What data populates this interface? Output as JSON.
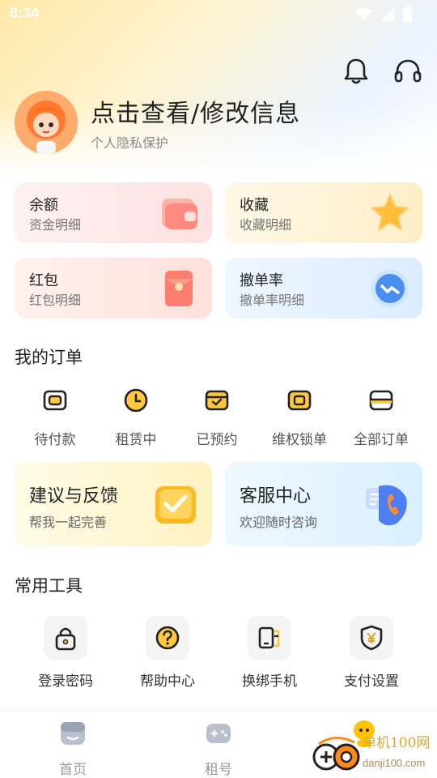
{
  "status_bar": {
    "time": "8:34"
  },
  "header": {
    "icons": [
      "bell-icon",
      "headset-icon"
    ]
  },
  "profile": {
    "title": "点击查看/修改信息",
    "subtitle": "个人隐私保护"
  },
  "assets": [
    {
      "title": "余额",
      "sub": "资金明细",
      "icon": "wallet-icon"
    },
    {
      "title": "收藏",
      "sub": "收藏明细",
      "icon": "star-icon"
    },
    {
      "title": "红包",
      "sub": "红包明细",
      "icon": "red-envelope-icon"
    },
    {
      "title": "撤单率",
      "sub": "撤单率明细",
      "icon": "trend-icon"
    }
  ],
  "orders": {
    "title": "我的订单",
    "items": [
      {
        "label": "待付款",
        "icon": "wallet-icon"
      },
      {
        "label": "租赁中",
        "icon": "clock-icon"
      },
      {
        "label": "已预约",
        "icon": "calendar-check-icon"
      },
      {
        "label": "维权锁单",
        "icon": "lock-order-icon"
      },
      {
        "label": "全部订单",
        "icon": "card-icon"
      }
    ]
  },
  "services": [
    {
      "title": "建议与反馈",
      "sub": "帮我一起完善",
      "icon": "checkbox-icon"
    },
    {
      "title": "客服中心",
      "sub": "欢迎随时咨询",
      "icon": "phone-icon"
    }
  ],
  "tools": {
    "title": "常用工具",
    "items": [
      {
        "label": "登录密码",
        "icon": "lock-icon"
      },
      {
        "label": "帮助中心",
        "icon": "question-icon"
      },
      {
        "label": "换绑手机",
        "icon": "phone-swap-icon"
      },
      {
        "label": "支付设置",
        "icon": "shield-yen-icon"
      }
    ]
  },
  "bottom_nav": [
    {
      "label": "首页",
      "icon": "home-icon"
    },
    {
      "label": "租号",
      "icon": "gamepad-icon"
    },
    {
      "label": "",
      "icon": "profile-icon",
      "active": true
    }
  ],
  "watermark": {
    "text_cn": "单机100网",
    "text_en": "danji100.com"
  },
  "colors": {
    "accent_yellow": "#ffc83d",
    "text_gray": "#8a8a8a",
    "nav_gray": "#9a9a9a"
  }
}
